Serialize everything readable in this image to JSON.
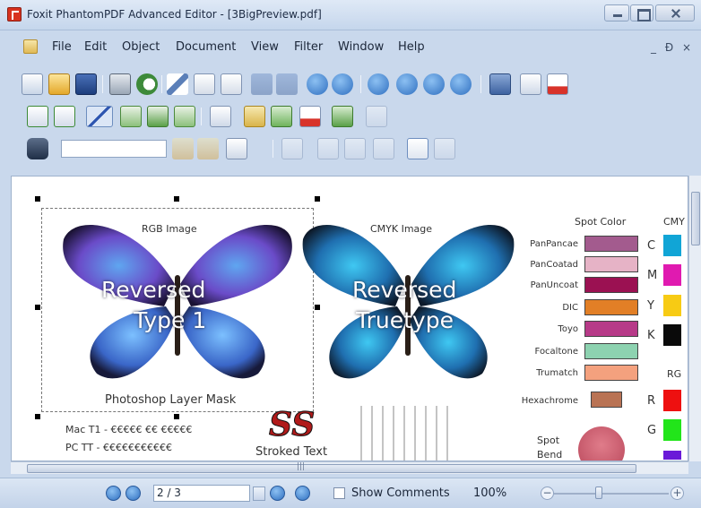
{
  "window": {
    "title": "Foxit PhantomPDF Advanced Editor - [3BigPreview.pdf]"
  },
  "menu": [
    "File",
    "Edit",
    "Object",
    "Document",
    "View",
    "Filter",
    "Window",
    "Help"
  ],
  "doc_controls": "_ Ɖ ×",
  "search": {
    "value": "",
    "placeholder": ""
  },
  "document": {
    "rgb_label": "RGB Image",
    "cmyk_label": "CMYK Image",
    "rev1_line1": "Reversed",
    "rev1_line2": "Type 1",
    "rev2_line1": "Reversed",
    "rev2_line2": "Truetype",
    "mask_label": "Photoshop Layer Mask",
    "mac_line": "Mac T1 - €€€€€ €€ €€€€€",
    "pc_line": "PC TT - €€€€€€€€€€€",
    "ss_logo": "SS",
    "stroked_text": "Stroked Text",
    "spot_title": "Spot Color",
    "cmyk_title": "CMY",
    "rgb_title": "RG",
    "spot_blend_1": "Spot",
    "spot_blend_2": "Bend",
    "spots": [
      {
        "name": "PanPancae",
        "color": "#a35b8e"
      },
      {
        "name": "PanCoatad",
        "color": "#e6b3c6"
      },
      {
        "name": "PanUncoat",
        "color": "#9b1152"
      },
      {
        "name": "DIC",
        "color": "#e27f26"
      },
      {
        "name": "Toyo",
        "color": "#b73a88"
      },
      {
        "name": "Focaltone",
        "color": "#8dd2b0"
      },
      {
        "name": "Trumatch",
        "color": "#f4a17e"
      },
      {
        "name": "Hexachrome",
        "color": "#b97354"
      }
    ],
    "cmyk": [
      {
        "label": "C",
        "color": "#11a5d6"
      },
      {
        "label": "M",
        "color": "#e01ab0"
      },
      {
        "label": "Y",
        "color": "#f7cb14"
      },
      {
        "label": "K",
        "color": "#0a0a0a"
      }
    ],
    "rgb": [
      {
        "label": "R",
        "color": "#ee1010"
      },
      {
        "label": "G",
        "color": "#22e51a"
      }
    ]
  },
  "status": {
    "page": "2 / 3",
    "show_comments": "Show Comments",
    "zoom": "100%"
  }
}
